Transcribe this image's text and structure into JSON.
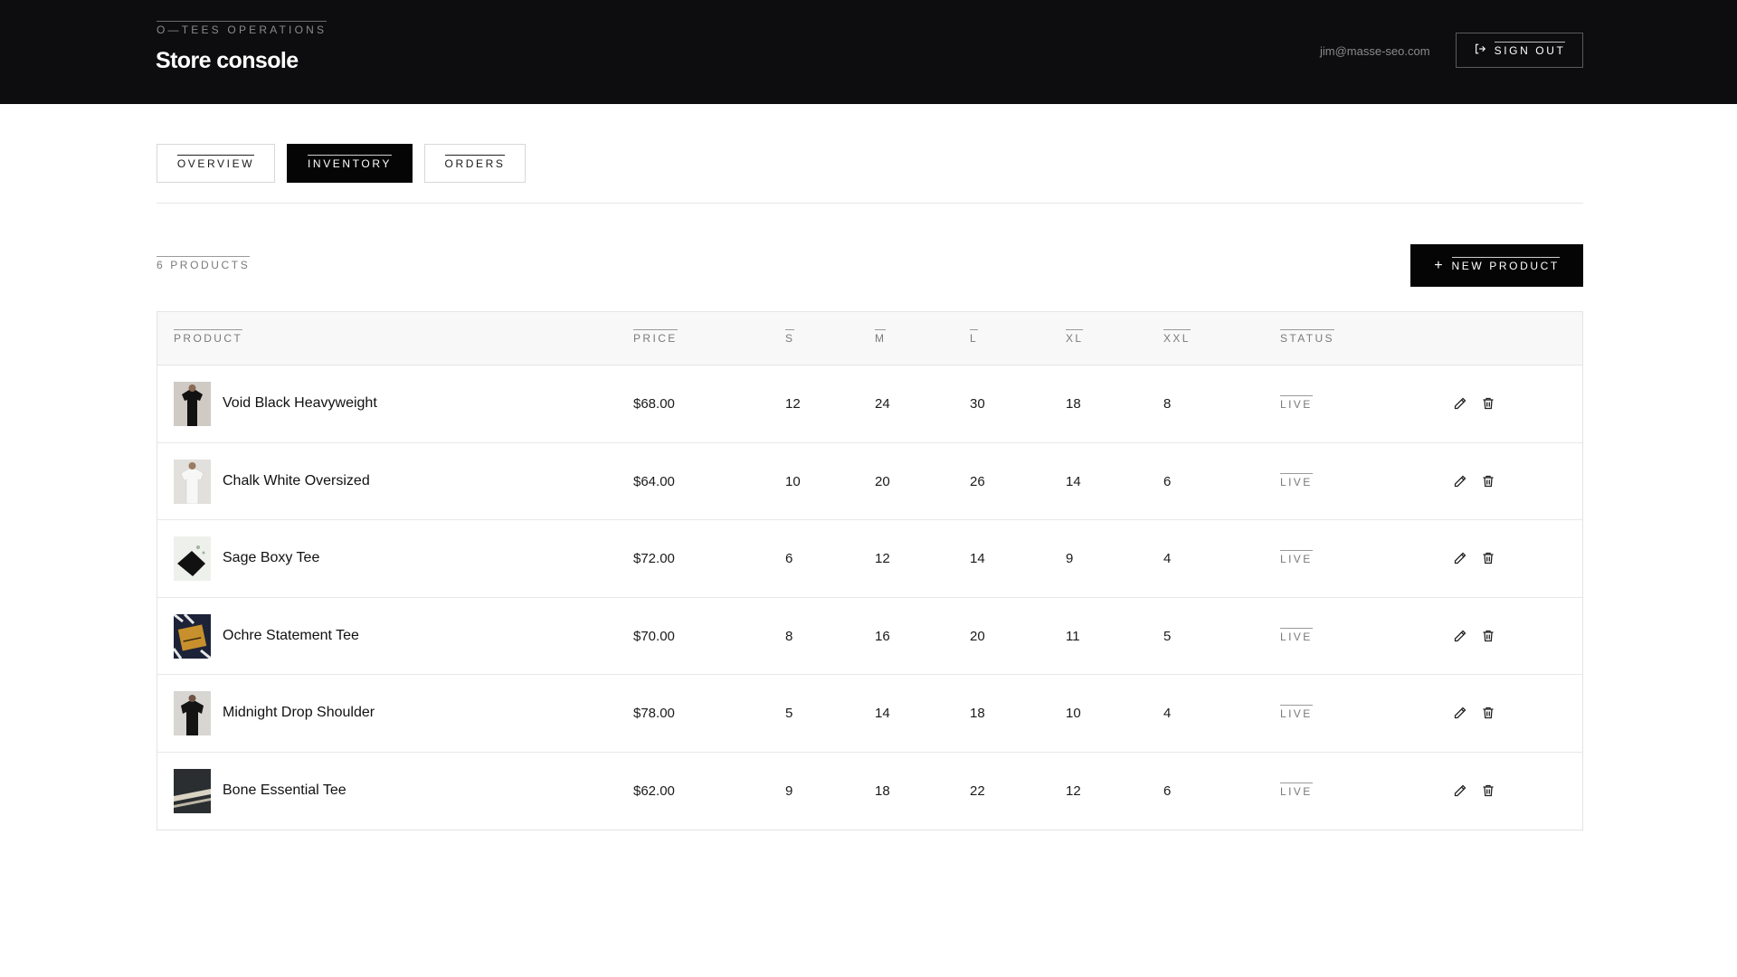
{
  "header": {
    "kicker": "O—TEES OPERATIONS",
    "title": "Store console",
    "user_email": "jim@masse-seo.com",
    "signout_label": "SIGN OUT",
    "background": "#0d0d0f"
  },
  "tabs": [
    {
      "label": "OVERVIEW",
      "active": false
    },
    {
      "label": "INVENTORY",
      "active": true
    },
    {
      "label": "ORDERS",
      "active": false
    }
  ],
  "toolbar": {
    "product_count": "6 PRODUCTS",
    "new_product_label": "NEW PRODUCT"
  },
  "table": {
    "columns": {
      "product": "PRODUCT",
      "price": "PRICE",
      "s": "S",
      "m": "M",
      "l": "L",
      "xl": "XL",
      "xxl": "XXL",
      "status": "STATUS"
    },
    "rows": [
      {
        "name": "Void Black Heavyweight",
        "price": "$68.00",
        "s": "12",
        "m": "24",
        "l": "30",
        "xl": "18",
        "xxl": "8",
        "status": "LIVE"
      },
      {
        "name": "Chalk White Oversized",
        "price": "$64.00",
        "s": "10",
        "m": "20",
        "l": "26",
        "xl": "14",
        "xxl": "6",
        "status": "LIVE"
      },
      {
        "name": "Sage Boxy Tee",
        "price": "$72.00",
        "s": "6",
        "m": "12",
        "l": "14",
        "xl": "9",
        "xxl": "4",
        "status": "LIVE"
      },
      {
        "name": "Ochre Statement Tee",
        "price": "$70.00",
        "s": "8",
        "m": "16",
        "l": "20",
        "xl": "11",
        "xxl": "5",
        "status": "LIVE"
      },
      {
        "name": "Midnight Drop Shoulder",
        "price": "$78.00",
        "s": "5",
        "m": "14",
        "l": "18",
        "xl": "10",
        "xxl": "4",
        "status": "LIVE"
      },
      {
        "name": "Bone Essential Tee",
        "price": "$62.00",
        "s": "9",
        "m": "18",
        "l": "22",
        "xl": "12",
        "xxl": "6",
        "status": "LIVE"
      }
    ]
  },
  "icons": {
    "signout": "sign-out-icon",
    "new_product": "plus-icon",
    "edit": "pencil-icon",
    "delete": "trash-icon"
  }
}
